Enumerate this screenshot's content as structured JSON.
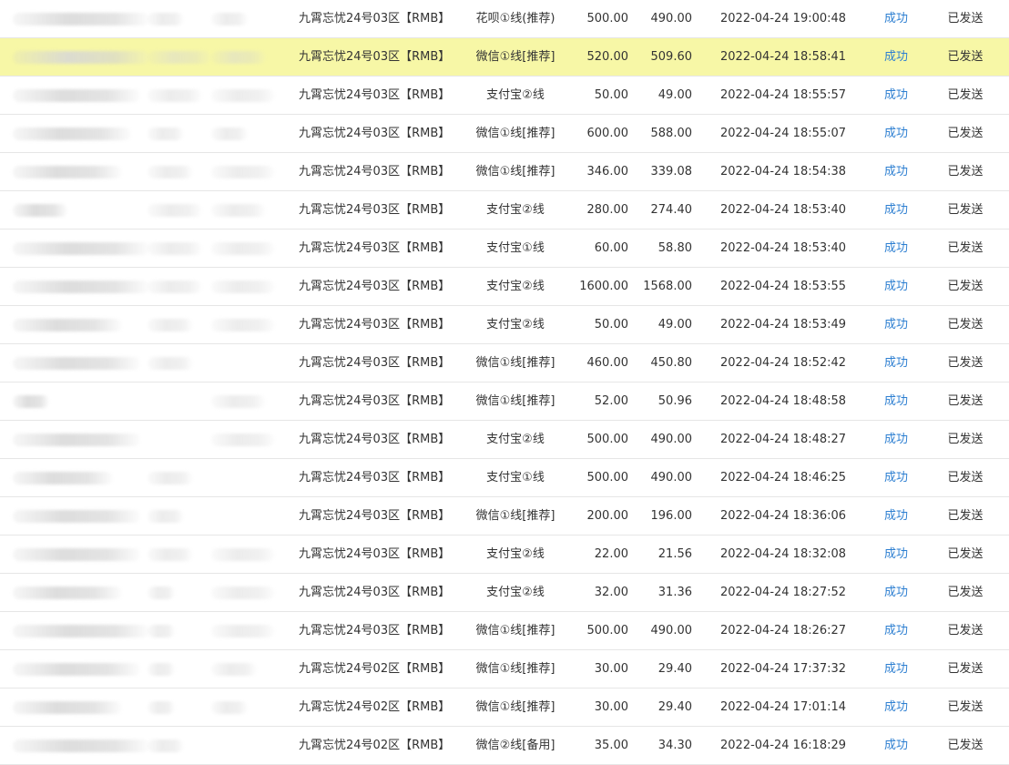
{
  "columns": [
    "order_no",
    "user",
    "phone",
    "server",
    "channel",
    "amount",
    "received",
    "time",
    "status",
    "notify"
  ],
  "highlight_row": 1,
  "rows": [
    {
      "order": "",
      "user": "",
      "phone": "",
      "server": "九霄忘忧24号03区【RMB】",
      "channel": "花呗①线(推荐)",
      "amount": "500.00",
      "received": "490.00",
      "time": "2022-04-24 19:00:48",
      "status": "成功",
      "notify": "已发送"
    },
    {
      "order": "",
      "user": "",
      "phone": "",
      "server": "九霄忘忧24号03区【RMB】",
      "channel": "微信①线[推荐]",
      "amount": "520.00",
      "received": "509.60",
      "time": "2022-04-24 18:58:41",
      "status": "成功",
      "notify": "已发送"
    },
    {
      "order": "",
      "user": "",
      "phone": "",
      "server": "九霄忘忧24号03区【RMB】",
      "channel": "支付宝②线",
      "amount": "50.00",
      "received": "49.00",
      "time": "2022-04-24 18:55:57",
      "status": "成功",
      "notify": "已发送"
    },
    {
      "order": "",
      "user": "",
      "phone": "",
      "server": "九霄忘忧24号03区【RMB】",
      "channel": "微信①线[推荐]",
      "amount": "600.00",
      "received": "588.00",
      "time": "2022-04-24 18:55:07",
      "status": "成功",
      "notify": "已发送"
    },
    {
      "order": "",
      "user": "",
      "phone": "",
      "server": "九霄忘忧24号03区【RMB】",
      "channel": "微信①线[推荐]",
      "amount": "346.00",
      "received": "339.08",
      "time": "2022-04-24 18:54:38",
      "status": "成功",
      "notify": "已发送"
    },
    {
      "order": "",
      "user": "",
      "phone": "",
      "server": "九霄忘忧24号03区【RMB】",
      "channel": "支付宝②线",
      "amount": "280.00",
      "received": "274.40",
      "time": "2022-04-24 18:53:40",
      "status": "成功",
      "notify": "已发送"
    },
    {
      "order": "",
      "user": "",
      "phone": "",
      "server": "九霄忘忧24号03区【RMB】",
      "channel": "支付宝①线",
      "amount": "60.00",
      "received": "58.80",
      "time": "2022-04-24 18:53:40",
      "status": "成功",
      "notify": "已发送"
    },
    {
      "order": "",
      "user": "",
      "phone": "",
      "server": "九霄忘忧24号03区【RMB】",
      "channel": "支付宝②线",
      "amount": "1600.00",
      "received": "1568.00",
      "time": "2022-04-24 18:53:55",
      "status": "成功",
      "notify": "已发送"
    },
    {
      "order": "",
      "user": "",
      "phone": "",
      "server": "九霄忘忧24号03区【RMB】",
      "channel": "支付宝②线",
      "amount": "50.00",
      "received": "49.00",
      "time": "2022-04-24 18:53:49",
      "status": "成功",
      "notify": "已发送"
    },
    {
      "order": "",
      "user": "",
      "phone": "",
      "server": "九霄忘忧24号03区【RMB】",
      "channel": "微信①线[推荐]",
      "amount": "460.00",
      "received": "450.80",
      "time": "2022-04-24 18:52:42",
      "status": "成功",
      "notify": "已发送"
    },
    {
      "order": "",
      "user": "",
      "phone": "",
      "server": "九霄忘忧24号03区【RMB】",
      "channel": "微信①线[推荐]",
      "amount": "52.00",
      "received": "50.96",
      "time": "2022-04-24 18:48:58",
      "status": "成功",
      "notify": "已发送"
    },
    {
      "order": "",
      "user": "",
      "phone": "",
      "server": "九霄忘忧24号03区【RMB】",
      "channel": "支付宝②线",
      "amount": "500.00",
      "received": "490.00",
      "time": "2022-04-24 18:48:27",
      "status": "成功",
      "notify": "已发送"
    },
    {
      "order": "",
      "user": "",
      "phone": "",
      "server": "九霄忘忧24号03区【RMB】",
      "channel": "支付宝①线",
      "amount": "500.00",
      "received": "490.00",
      "time": "2022-04-24 18:46:25",
      "status": "成功",
      "notify": "已发送"
    },
    {
      "order": "",
      "user": "",
      "phone": "",
      "server": "九霄忘忧24号03区【RMB】",
      "channel": "微信①线[推荐]",
      "amount": "200.00",
      "received": "196.00",
      "time": "2022-04-24 18:36:06",
      "status": "成功",
      "notify": "已发送"
    },
    {
      "order": "",
      "user": "",
      "phone": "",
      "server": "九霄忘忧24号03区【RMB】",
      "channel": "支付宝②线",
      "amount": "22.00",
      "received": "21.56",
      "time": "2022-04-24 18:32:08",
      "status": "成功",
      "notify": "已发送"
    },
    {
      "order": "",
      "user": "",
      "phone": "",
      "server": "九霄忘忧24号03区【RMB】",
      "channel": "支付宝②线",
      "amount": "32.00",
      "received": "31.36",
      "time": "2022-04-24 18:27:52",
      "status": "成功",
      "notify": "已发送"
    },
    {
      "order": "",
      "user": "",
      "phone": "",
      "server": "九霄忘忧24号03区【RMB】",
      "channel": "微信①线[推荐]",
      "amount": "500.00",
      "received": "490.00",
      "time": "2022-04-24 18:26:27",
      "status": "成功",
      "notify": "已发送"
    },
    {
      "order": "",
      "user": "",
      "phone": "",
      "server": "九霄忘忧24号02区【RMB】",
      "channel": "微信①线[推荐]",
      "amount": "30.00",
      "received": "29.40",
      "time": "2022-04-24 17:37:32",
      "status": "成功",
      "notify": "已发送"
    },
    {
      "order": "",
      "user": "",
      "phone": "",
      "server": "九霄忘忧24号02区【RMB】",
      "channel": "微信①线[推荐]",
      "amount": "30.00",
      "received": "29.40",
      "time": "2022-04-24 17:01:14",
      "status": "成功",
      "notify": "已发送"
    },
    {
      "order": "",
      "user": "",
      "phone": "",
      "server": "九霄忘忧24号02区【RMB】",
      "channel": "微信②线[备用]",
      "amount": "35.00",
      "received": "34.30",
      "time": "2022-04-24 16:18:29",
      "status": "成功",
      "notify": "已发送"
    }
  ]
}
